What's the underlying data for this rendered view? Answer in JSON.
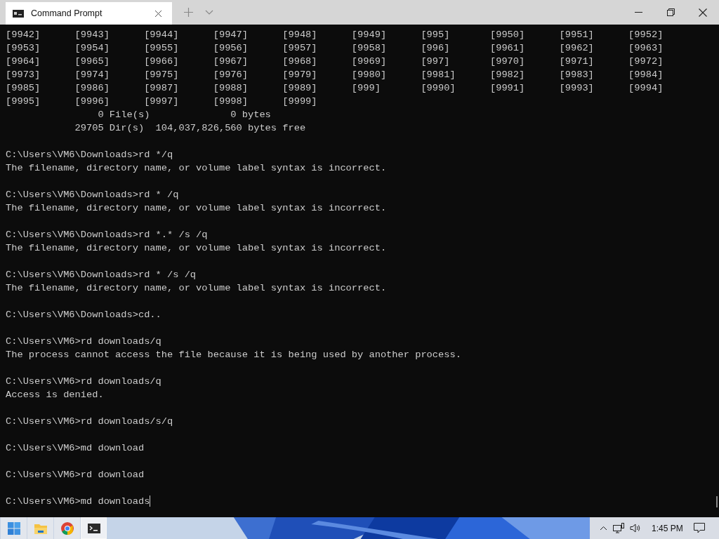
{
  "window": {
    "tab_title": "Command Prompt"
  },
  "terminal": {
    "listing": [
      "[9942]      [9943]      [9944]      [9947]      [9948]      [9949]      [995]       [9950]      [9951]      [9952]",
      "[9953]      [9954]      [9955]      [9956]      [9957]      [9958]      [996]       [9961]      [9962]      [9963]",
      "[9964]      [9965]      [9966]      [9967]      [9968]      [9969]      [997]       [9970]      [9971]      [9972]",
      "[9973]      [9974]      [9975]      [9976]      [9979]      [9980]      [9981]      [9982]      [9983]      [9984]",
      "[9985]      [9986]      [9987]      [9988]      [9989]      [999]       [9990]      [9991]      [9993]      [9994]",
      "[9995]      [9996]      [9997]      [9998]      [9999]",
      "                0 File(s)              0 bytes",
      "            29705 Dir(s)  104,037,826,560 bytes free"
    ],
    "commands": [
      {
        "prompt": "C:\\Users\\VM6\\Downloads>",
        "command": "rd */q",
        "output": [
          "The filename, directory name, or volume label syntax is incorrect."
        ],
        "cursor": false
      },
      {
        "prompt": "C:\\Users\\VM6\\Downloads>",
        "command": "rd * /q",
        "output": [
          "The filename, directory name, or volume label syntax is incorrect."
        ],
        "cursor": false
      },
      {
        "prompt": "C:\\Users\\VM6\\Downloads>",
        "command": "rd *.* /s /q",
        "output": [
          "The filename, directory name, or volume label syntax is incorrect."
        ],
        "cursor": false
      },
      {
        "prompt": "C:\\Users\\VM6\\Downloads>",
        "command": "rd * /s /q",
        "output": [
          "The filename, directory name, or volume label syntax is incorrect."
        ],
        "cursor": false
      },
      {
        "prompt": "C:\\Users\\VM6\\Downloads>",
        "command": "cd..",
        "cursor": false
      },
      {
        "prompt": "C:\\Users\\VM6>",
        "command": "rd downloads/q",
        "output": [
          "The process cannot access the file because it is being used by another process."
        ],
        "cursor": false
      },
      {
        "prompt": "C:\\Users\\VM6>",
        "command": "rd downloads/q",
        "output": [
          "Access is denied."
        ],
        "cursor": false
      },
      {
        "prompt": "C:\\Users\\VM6>",
        "command": "rd downloads/s/q",
        "cursor": false
      },
      {
        "prompt": "C:\\Users\\VM6>",
        "command": "md download",
        "cursor": false
      },
      {
        "prompt": "C:\\Users\\VM6>",
        "command": "rd download",
        "cursor": false
      },
      {
        "prompt": "C:\\Users\\VM6>",
        "command": "md downloads",
        "cursor": true
      }
    ]
  },
  "taskbar": {
    "apps": [
      {
        "kind": "start",
        "selected": false
      },
      {
        "kind": "folder",
        "selected": false
      },
      {
        "kind": "browser",
        "selected": false
      },
      {
        "kind": "terminal",
        "selected": true
      }
    ],
    "clock": "1:45 PM"
  }
}
